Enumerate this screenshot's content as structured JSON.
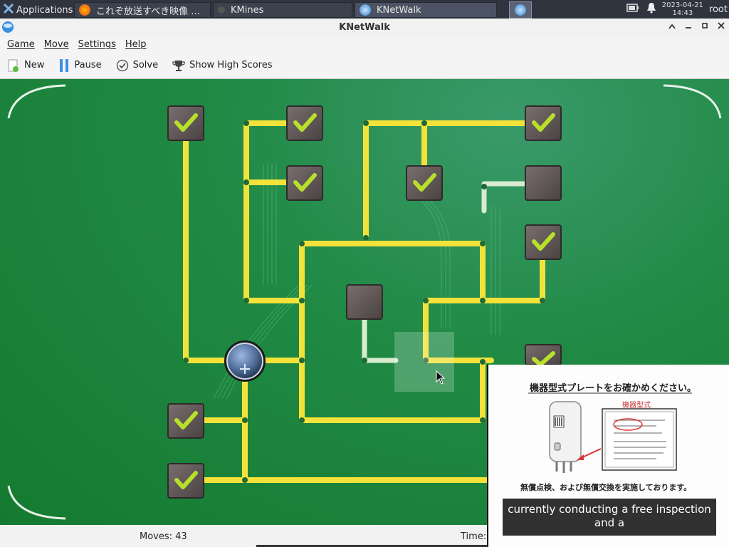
{
  "taskbar": {
    "applications_label": "Applications",
    "windows": [
      {
        "label": "これぞ放送すべき映像 企…",
        "icon": "firefox-icon"
      },
      {
        "label": "KMines",
        "icon": "kmines-icon"
      },
      {
        "label": "KNetWalk",
        "icon": "knetwalk-icon"
      }
    ],
    "date": "2023-04-21",
    "time": "14:43",
    "user": "root"
  },
  "window": {
    "title": "KNetWalk"
  },
  "menu": {
    "game": "Game",
    "move": "Move",
    "settings": "Settings",
    "help": "Help"
  },
  "toolbar": {
    "new": "New",
    "pause": "Pause",
    "solve": "Solve",
    "high_scores": "Show High Scores"
  },
  "status": {
    "moves": "Moves: 43",
    "time": "Time:"
  },
  "video": {
    "heading": "機器型式プレートをお確かめください。",
    "line2": "無償点検、および無償交換を実施しております。",
    "part_label": "機器型式",
    "subtitle_line1": "currently conducting a free inspection",
    "subtitle_line2": "and a"
  },
  "colors": {
    "board": "#1f8a45",
    "wire_on": "#f2e23a",
    "wire_off": "#d8ecd0",
    "check": "#b8e02a"
  }
}
